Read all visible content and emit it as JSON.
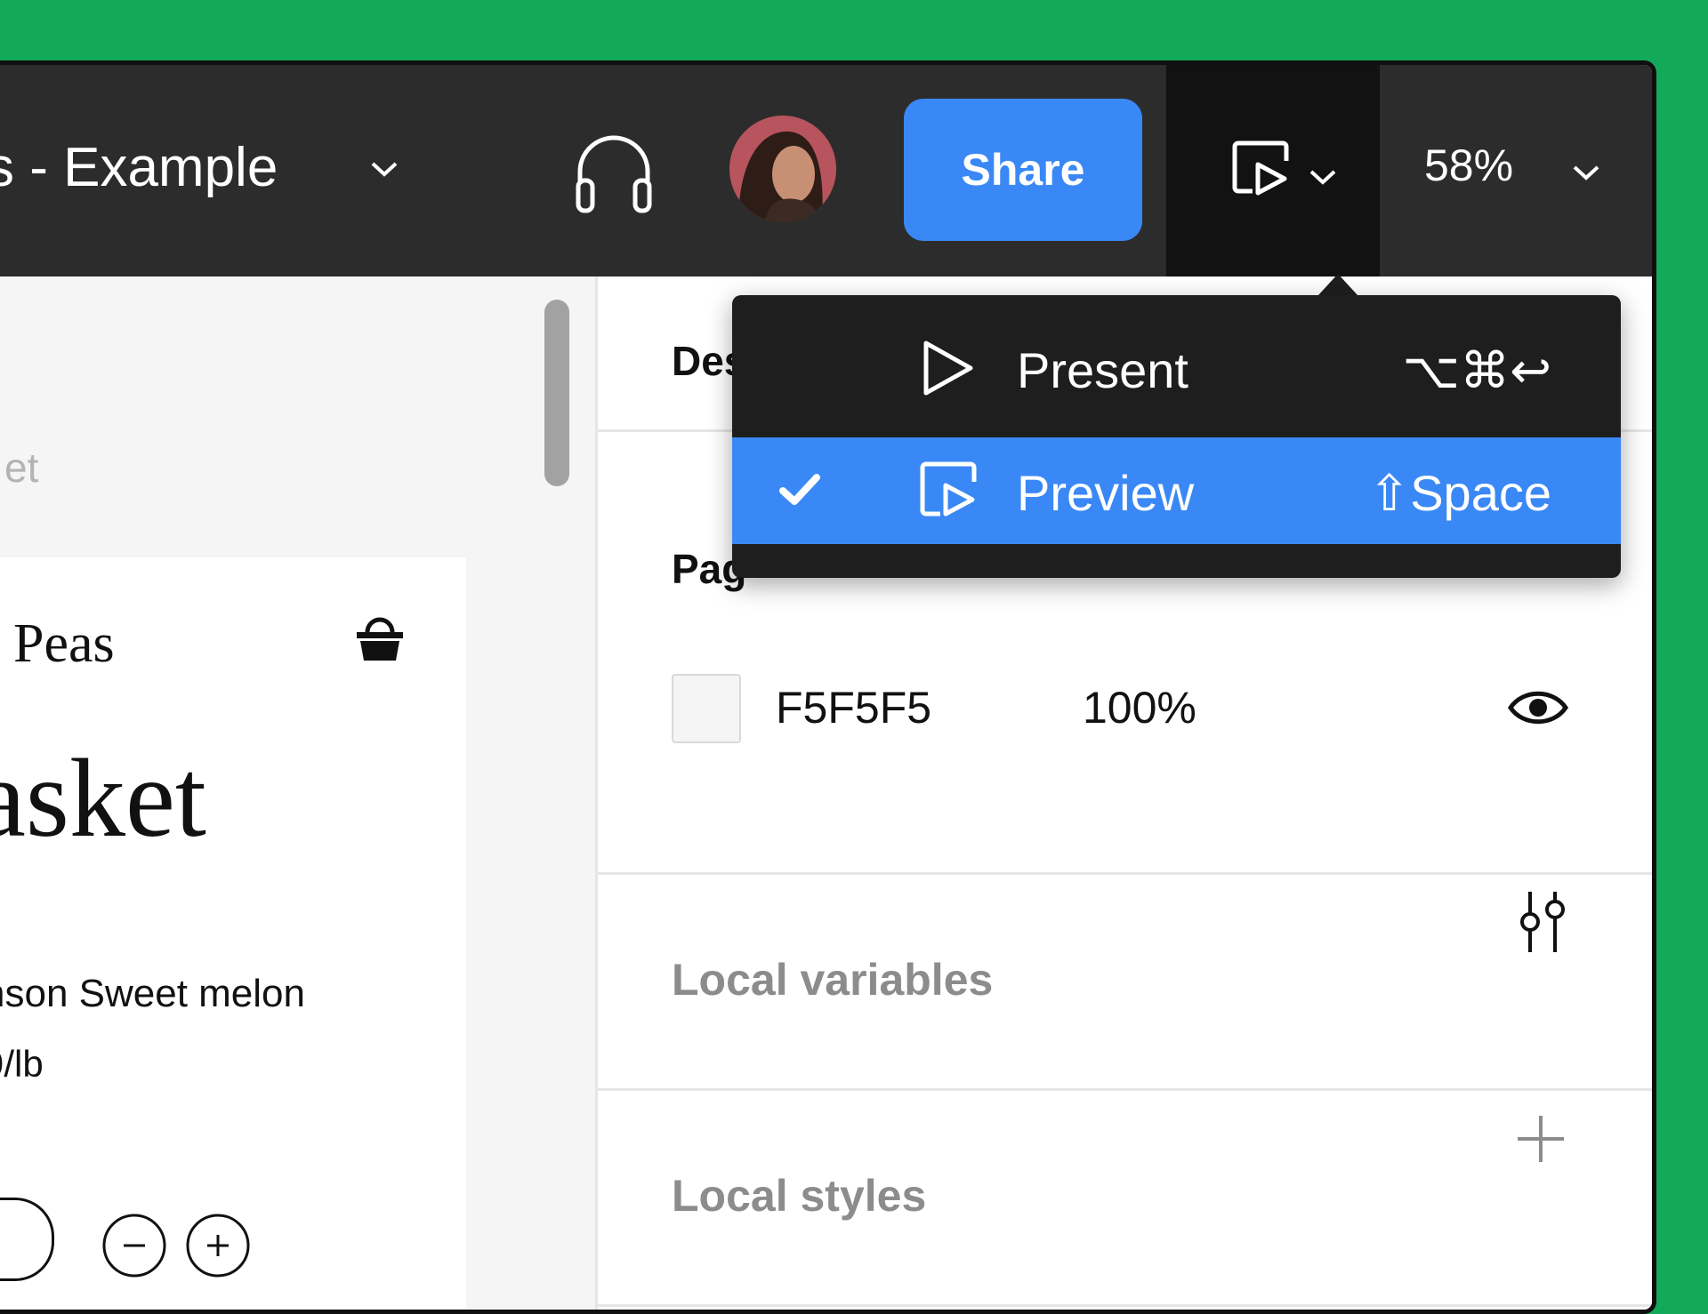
{
  "header": {
    "file_title": "s - Example",
    "share_label": "Share",
    "zoom": "58%"
  },
  "canvas": {
    "frame_label": "et",
    "brand": "Peas",
    "heading": "asket",
    "product_name": "nson Sweet melon",
    "price": "9/lb"
  },
  "panel": {
    "tab_label": "Des",
    "page_heading": "Pag",
    "page_color": {
      "hex": "F5F5F5",
      "opacity": "100%"
    },
    "local_variables": "Local variables",
    "local_styles": "Local styles"
  },
  "menu": {
    "items": [
      {
        "label": "Present",
        "shortcut": "⌥⌘↩",
        "checked": false
      },
      {
        "label": "Preview",
        "shortcut": "⇧Space",
        "checked": true
      }
    ]
  },
  "colors": {
    "accent": "#3a88f5",
    "background": "#13a95a",
    "toolbar": "#2c2c2c"
  }
}
